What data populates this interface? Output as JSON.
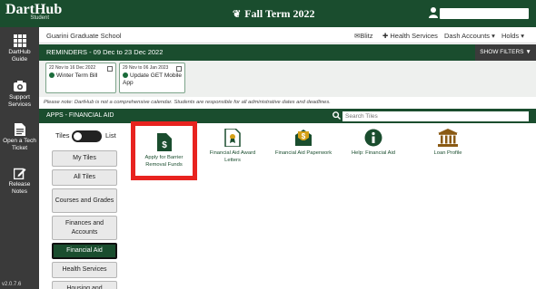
{
  "app": {
    "brand": "DartHub",
    "brand_sub": "Student",
    "term": "Fall Term 2022"
  },
  "user": {
    "name": ""
  },
  "leftnav": {
    "items": [
      {
        "label1": "DartHub",
        "label2": "Guide"
      },
      {
        "label1": "Support",
        "label2": "Services"
      },
      {
        "label1": "Open a Tech",
        "label2": "Ticket"
      },
      {
        "label1": "Release",
        "label2": "Notes"
      }
    ],
    "version": "v2.0.7.6"
  },
  "header": {
    "school": "Guarini Graduate School",
    "links": {
      "blitz": "Blitz",
      "health": "Health Services",
      "dash": "Dash Accounts",
      "holds": "Holds"
    }
  },
  "reminders": {
    "title": "REMINDERS - 09 Dec to 23 Dec 2022",
    "show_filters": "SHOW FILTERS",
    "cards": [
      {
        "date": "22 Nov to 16 Dec 2022",
        "title": "Winter Term Bill"
      },
      {
        "date": "29 Nov to 06 Jan 2023",
        "title": "Update GET Mobile App"
      }
    ],
    "note": "Please note: DartHub is not a comprehensive calendar. Students are responsible for all administrative dates and deadlines."
  },
  "apps": {
    "title": "APPS - FINANCIAL AID",
    "search_placeholder": "Search Tiles"
  },
  "view_toggle": {
    "left": "Tiles",
    "right": "List"
  },
  "categories": [
    "My Tiles",
    "All Tiles",
    "Courses and Grades",
    "Finances and Accounts",
    "Financial Aid",
    "Health Services",
    "Housing and"
  ],
  "active_category": "Financial Aid",
  "tiles": [
    {
      "label": "Apply for Barrier Removal Funds",
      "icon": "document-dollar-icon"
    },
    {
      "label": "Financial Aid Award Letters",
      "icon": "award-document-icon"
    },
    {
      "label": "Financial Aid Paperwork",
      "icon": "envelope-dollar-icon"
    },
    {
      "label": "Help: Financial Aid",
      "icon": "info-icon"
    },
    {
      "label": "Loan Profile",
      "icon": "bank-icon"
    }
  ],
  "colors": {
    "brand_green": "#1a4d2e",
    "dark_gray": "#3a3a3a",
    "highlight_red": "#e8231f"
  }
}
